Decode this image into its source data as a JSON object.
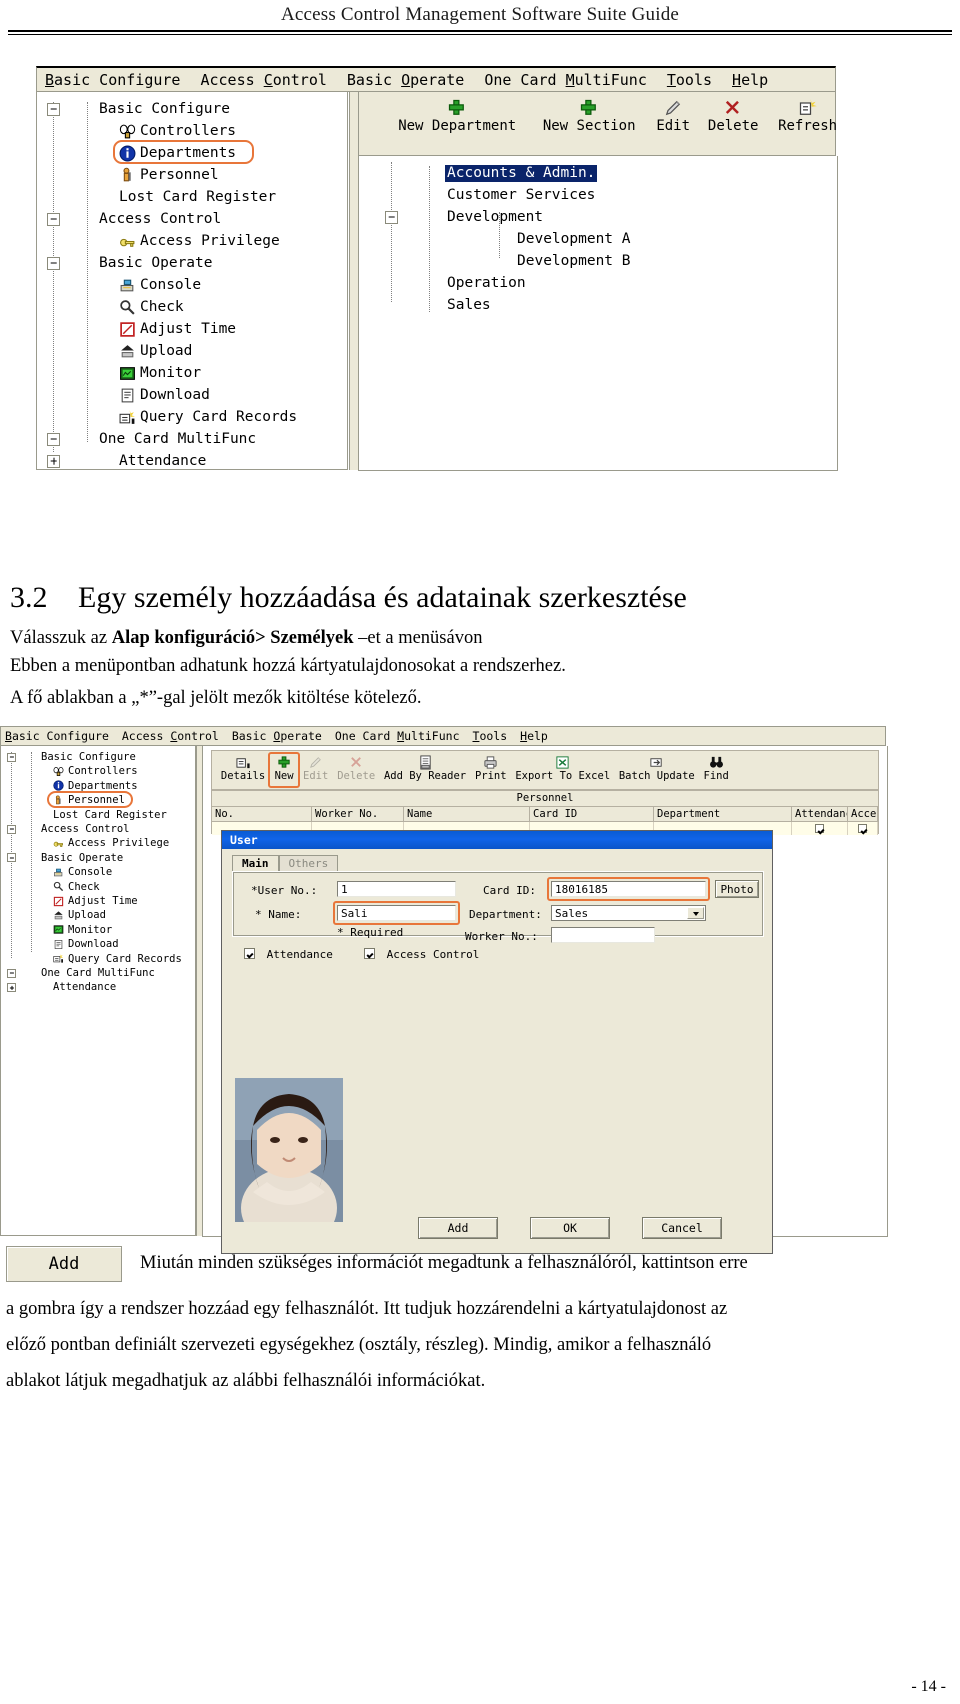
{
  "running_head": "Access Control Management Software Suite Guide",
  "page_number": "- 14 -",
  "accent_highlight_color": "#e8763a",
  "selection_color": "#0a246a",
  "screenshot_top": {
    "menubar": [
      {
        "label": "Basic Configure",
        "accel": "B"
      },
      {
        "label": "Access Control",
        "accel": "C"
      },
      {
        "label": "Basic Operate",
        "accel": "O"
      },
      {
        "label": "One Card MultiFunc",
        "accel": "M"
      },
      {
        "label": "Tools",
        "accel": "T"
      },
      {
        "label": "Help",
        "accel": "H"
      }
    ],
    "tree": [
      {
        "label": "Basic Configure",
        "level": 0,
        "expander": "minus",
        "icon": ""
      },
      {
        "label": "Controllers",
        "level": 1,
        "expander": "",
        "icon": "controllers-icon"
      },
      {
        "label": "Departments",
        "level": 1,
        "expander": "",
        "icon": "departments-info-icon",
        "highlighted": true
      },
      {
        "label": "Personnel",
        "level": 1,
        "expander": "",
        "icon": "personnel-icon"
      },
      {
        "label": "Lost Card Register",
        "level": 1,
        "expander": "",
        "icon": ""
      },
      {
        "label": "Access Control",
        "level": 0,
        "expander": "minus",
        "icon": ""
      },
      {
        "label": "Access Privilege",
        "level": 1,
        "expander": "",
        "icon": "key-icon"
      },
      {
        "label": "Basic Operate",
        "level": 0,
        "expander": "minus",
        "icon": ""
      },
      {
        "label": "Console",
        "level": 1,
        "expander": "",
        "icon": "console-icon"
      },
      {
        "label": "Check",
        "level": 1,
        "expander": "",
        "icon": "check-icon"
      },
      {
        "label": "Adjust Time",
        "level": 1,
        "expander": "",
        "icon": "adjust-time-icon"
      },
      {
        "label": "Upload",
        "level": 1,
        "expander": "",
        "icon": "upload-icon"
      },
      {
        "label": "Monitor",
        "level": 1,
        "expander": "",
        "icon": "monitor-icon"
      },
      {
        "label": "Download",
        "level": 1,
        "expander": "",
        "icon": "download-icon"
      },
      {
        "label": "Query Card Records",
        "level": 1,
        "expander": "",
        "icon": "query-card-records-icon"
      },
      {
        "label": "One Card MultiFunc",
        "level": 0,
        "expander": "minus",
        "icon": ""
      },
      {
        "label": "Attendance",
        "level": 1,
        "expander": "plus",
        "icon": ""
      }
    ],
    "toolbar": [
      {
        "label": "New Department",
        "icon": "green-plus-icon"
      },
      {
        "label": "New Section",
        "icon": "green-plus-icon"
      },
      {
        "label": "Edit",
        "icon": "pencil-icon"
      },
      {
        "label": "Delete",
        "icon": "red-x-icon"
      },
      {
        "label": "Refresh",
        "icon": "refresh-icon"
      }
    ],
    "department_tree": [
      {
        "label": "Accounts & Admin.",
        "level": 0,
        "selected": true,
        "expander": ""
      },
      {
        "label": "Customer Services",
        "level": 0,
        "selected": false,
        "expander": ""
      },
      {
        "label": "Development",
        "level": 0,
        "selected": false,
        "expander": "minus"
      },
      {
        "label": "Development A",
        "level": 1,
        "selected": false,
        "expander": ""
      },
      {
        "label": "Development B",
        "level": 1,
        "selected": false,
        "expander": ""
      },
      {
        "label": "Operation",
        "level": 0,
        "selected": false,
        "expander": ""
      },
      {
        "label": "Sales",
        "level": 0,
        "selected": false,
        "expander": ""
      }
    ]
  },
  "heading": {
    "number": "3.2",
    "text": "Egy személy hozzáadása és adatainak szerkesztése"
  },
  "intro": {
    "line1_pre": "Válasszuk az ",
    "line1_bold": "Alap konfiguráció> Személyek",
    "line1_post": " –et a menüsávon",
    "line2": "Ebben a menüpontban adhatunk hozzá kártyatulajdonosokat a rendszerhez.",
    "line3": "A fő ablakban a „*”-gal jelölt mezők kitöltése kötelező."
  },
  "screenshot_bottom": {
    "menubar": [
      {
        "label": "Basic Configure",
        "accel": "B"
      },
      {
        "label": "Access Control",
        "accel": "C"
      },
      {
        "label": "Basic Operate",
        "accel": "O"
      },
      {
        "label": "One Card MultiFunc",
        "accel": "M"
      },
      {
        "label": "Tools",
        "accel": "T"
      },
      {
        "label": "Help",
        "accel": "H"
      }
    ],
    "tree": [
      {
        "label": "Basic Configure",
        "level": 0,
        "expander": "minus",
        "icon": ""
      },
      {
        "label": "Controllers",
        "level": 1,
        "expander": "",
        "icon": "controllers-icon"
      },
      {
        "label": "Departments",
        "level": 1,
        "expander": "",
        "icon": "departments-info-icon"
      },
      {
        "label": "Personnel",
        "level": 1,
        "expander": "",
        "icon": "personnel-icon",
        "highlighted": true
      },
      {
        "label": "Lost Card Register",
        "level": 1,
        "expander": "",
        "icon": ""
      },
      {
        "label": "Access Control",
        "level": 0,
        "expander": "minus",
        "icon": ""
      },
      {
        "label": "Access Privilege",
        "level": 1,
        "expander": "",
        "icon": "key-icon"
      },
      {
        "label": "Basic Operate",
        "level": 0,
        "expander": "minus",
        "icon": ""
      },
      {
        "label": "Console",
        "level": 1,
        "expander": "",
        "icon": "console-icon"
      },
      {
        "label": "Check",
        "level": 1,
        "expander": "",
        "icon": "check-icon"
      },
      {
        "label": "Adjust Time",
        "level": 1,
        "expander": "",
        "icon": "adjust-time-icon"
      },
      {
        "label": "Upload",
        "level": 1,
        "expander": "",
        "icon": "upload-icon"
      },
      {
        "label": "Monitor",
        "level": 1,
        "expander": "",
        "icon": "monitor-icon"
      },
      {
        "label": "Download",
        "level": 1,
        "expander": "",
        "icon": "download-icon"
      },
      {
        "label": "Query Card Records",
        "level": 1,
        "expander": "",
        "icon": "query-card-records-icon"
      },
      {
        "label": "One Card MultiFunc",
        "level": 0,
        "expander": "minus",
        "icon": ""
      },
      {
        "label": "Attendance",
        "level": 1,
        "expander": "plus",
        "icon": ""
      }
    ],
    "toolbar": [
      {
        "label": "Details",
        "icon": "details-icon"
      },
      {
        "label": "New",
        "icon": "green-plus-icon",
        "highlighted": true
      },
      {
        "label": "Edit",
        "icon": "pencil-icon",
        "disabled": true
      },
      {
        "label": "Delete",
        "icon": "red-x-icon",
        "disabled": true
      },
      {
        "label": "Add By Reader",
        "icon": "card-reader-icon"
      },
      {
        "label": "Print",
        "icon": "printer-icon"
      },
      {
        "label": "Export To Excel",
        "icon": "excel-icon"
      },
      {
        "label": "Batch Update",
        "icon": "batch-update-icon"
      },
      {
        "label": "Find",
        "icon": "binoculars-icon"
      }
    ],
    "grid": {
      "caption": "Personnel",
      "columns": [
        "No.",
        "Worker No.",
        "Name",
        "Card ID",
        "Department",
        "Attendance",
        "Access Control"
      ],
      "rows": [
        {
          "No.": "",
          "Worker No.": "",
          "Name": "",
          "Card ID": "",
          "Department": "",
          "Attendance": true,
          "Access Control": true
        }
      ]
    },
    "user_dialog": {
      "title": "User",
      "tabs": [
        {
          "label": "Main",
          "active": true
        },
        {
          "label": "Others",
          "active": false
        }
      ],
      "fields": [
        {
          "label": "*User No.:",
          "value": "1",
          "type": "text",
          "highlighted": false
        },
        {
          "label": "* Name:",
          "value": "Sali",
          "type": "text",
          "highlighted": true
        },
        {
          "label": "Card ID:",
          "value": "18016185",
          "type": "text",
          "highlighted": true
        },
        {
          "label": "Department:",
          "value": "Sales",
          "type": "combo",
          "highlighted": false
        },
        {
          "label": "Worker No.:",
          "value": "",
          "type": "text",
          "highlighted": false
        }
      ],
      "required_note": "* Required",
      "photo_button": "Photo",
      "checkboxes": [
        {
          "label": "Attendance",
          "checked": true
        },
        {
          "label": "Access Control",
          "checked": true
        }
      ],
      "buttons": [
        {
          "label": "Add",
          "name": "add-button"
        },
        {
          "label": "OK",
          "name": "ok-button"
        },
        {
          "label": "Cancel",
          "name": "cancel-button"
        }
      ],
      "photo_alt": "user-portrait"
    }
  },
  "add_caption_button": "Add",
  "closing": {
    "line1": "Miután minden szükséges információt megadtunk a felhasználóról, kattintson erre",
    "line2": "a gombra így a rendszer hozzáad egy felhasználót. Itt tudjuk hozzárendelni a kártyatulajdonost az",
    "line3": "előző pontban definiált szervezeti egységekhez (osztály, részleg). Mindig, amikor a felhasználó",
    "line4": "ablakot látjuk megadhatjuk az alábbi felhasználói információkat."
  }
}
